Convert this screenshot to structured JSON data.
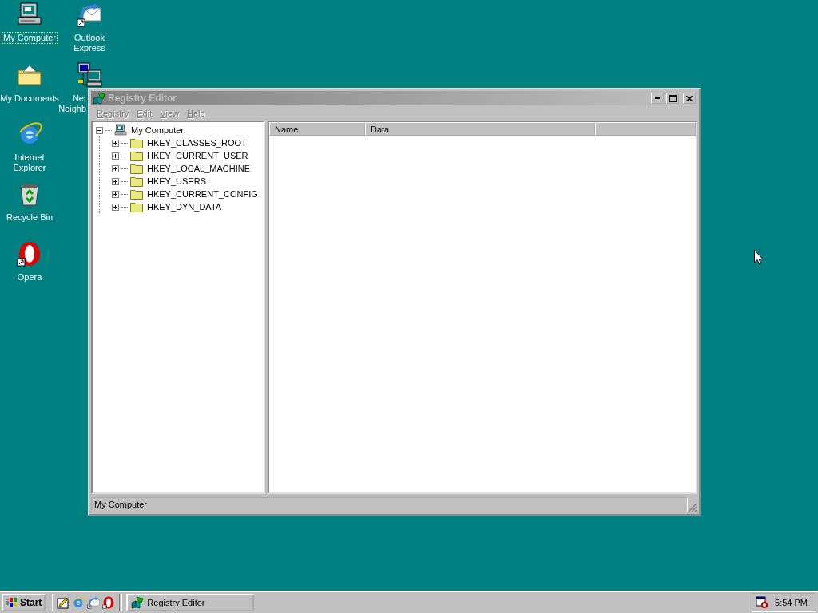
{
  "desktop": {
    "icons": [
      {
        "kind": "computer",
        "lines": [
          "My Computer"
        ],
        "focused": true
      },
      {
        "kind": "outlook",
        "lines": [
          "Outlook",
          "Express"
        ],
        "focused": false
      },
      {
        "kind": "documents",
        "lines": [
          "My Documents"
        ],
        "focused": false
      },
      {
        "kind": "network",
        "lines": [
          "Net",
          "Neighb"
        ],
        "focused": false
      },
      {
        "kind": "ie",
        "lines": [
          "Internet",
          "Explorer"
        ],
        "focused": false
      },
      {
        "kind": "recycle",
        "lines": [
          "Recycle Bin"
        ],
        "focused": false
      },
      {
        "kind": "opera",
        "lines": [
          "Opera"
        ],
        "focused": false
      }
    ]
  },
  "window": {
    "title": "Registry Editor",
    "active": false,
    "menu": [
      {
        "label": "Registry",
        "disabled": true
      },
      {
        "label": "Edit",
        "disabled": true
      },
      {
        "label": "View",
        "disabled": true
      },
      {
        "label": "Help",
        "disabled": true
      }
    ],
    "tree": {
      "label": "My Computer",
      "expanded": true,
      "children": [
        {
          "label": "HKEY_CLASSES_ROOT",
          "expanded": false
        },
        {
          "label": "HKEY_CURRENT_USER",
          "expanded": false
        },
        {
          "label": "HKEY_LOCAL_MACHINE",
          "expanded": false
        },
        {
          "label": "HKEY_USERS",
          "expanded": false
        },
        {
          "label": "HKEY_CURRENT_CONFIG",
          "expanded": false
        },
        {
          "label": "HKEY_DYN_DATA",
          "expanded": false
        }
      ]
    },
    "columns": [
      "Name",
      "Data"
    ],
    "status_bar": "My Computer"
  },
  "taskbar": {
    "start": "Start",
    "quick_launch": [
      {
        "kind": "desktop"
      },
      {
        "kind": "ie"
      },
      {
        "kind": "outlook"
      },
      {
        "kind": "opera"
      }
    ],
    "tasks": [
      {
        "label": "Registry Editor",
        "selected": false
      }
    ],
    "clock": "5:54 PM"
  }
}
